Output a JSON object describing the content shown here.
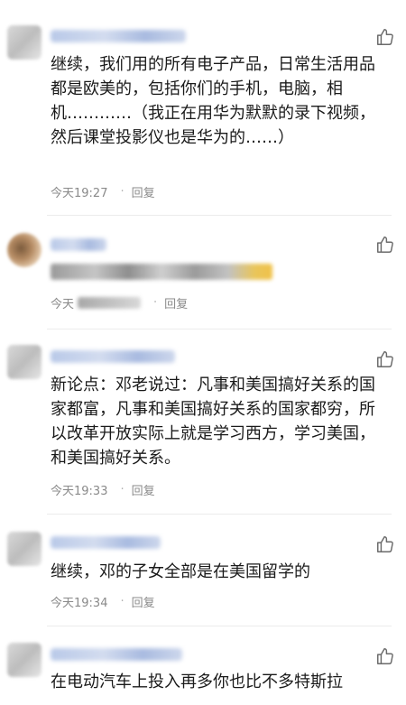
{
  "comments": [
    {
      "text": "继续，我们用的所有电子产品，日常生活用品都是欧美的，包括你们的手机，电脑，相机…………（我正在用华为默默的录下视频，然后课堂投影仪也是华为的……）",
      "time": "今天19:27",
      "reply": "回复"
    },
    {
      "time": "今天",
      "reply": "回复"
    },
    {
      "text": "新论点：邓老说过：凡事和美国搞好关系的国家都富，凡事和美国搞好关系的国家都穷，所以改革开放实际上就是学习西方，学习美国，和美国搞好关系。",
      "time": "今天19:33",
      "reply": "回复"
    },
    {
      "text": "继续，邓的子女全部是在美国留学的",
      "time": "今天19:34",
      "reply": "回复"
    },
    {
      "text": "在电动汽车上投入再多你也比不多特斯拉"
    }
  ],
  "icons": {
    "like": "thumbs-up-icon"
  }
}
